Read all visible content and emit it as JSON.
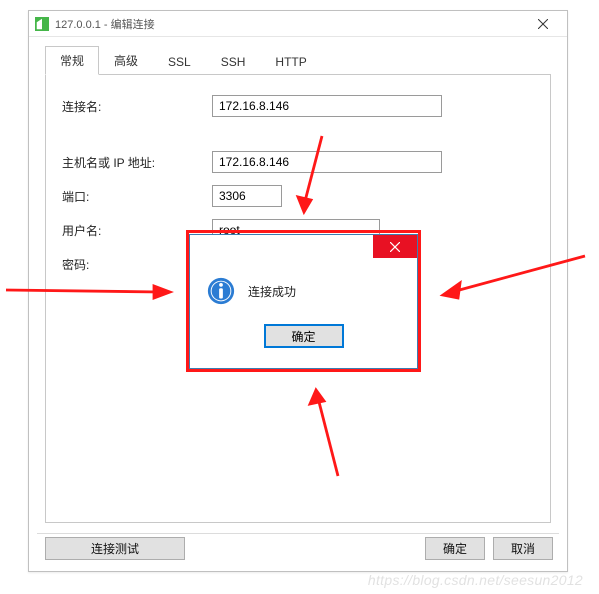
{
  "window": {
    "title": "127.0.0.1 - 编辑连接"
  },
  "tabs": {
    "general": "常规",
    "advanced": "高级",
    "ssl": "SSL",
    "ssh": "SSH",
    "http": "HTTP"
  },
  "fields": {
    "connection_name_label": "连接名:",
    "connection_name_value": "172.16.8.146",
    "host_label": "主机名或 IP 地址:",
    "host_value": "172.16.8.146",
    "port_label": "端口:",
    "port_value": "3306",
    "user_label": "用户名:",
    "user_value": "root",
    "password_label": "密码:",
    "password_value": "•••••••"
  },
  "buttons": {
    "test": "连接测试",
    "ok": "确定",
    "cancel": "取消"
  },
  "dialog": {
    "message": "连接成功",
    "ok": "确定"
  },
  "watermark": "https://blog.csdn.net/seesun2012",
  "colors": {
    "annotation": "#ff1818",
    "close_btn": "#e81123",
    "focus": "#0078d7"
  }
}
